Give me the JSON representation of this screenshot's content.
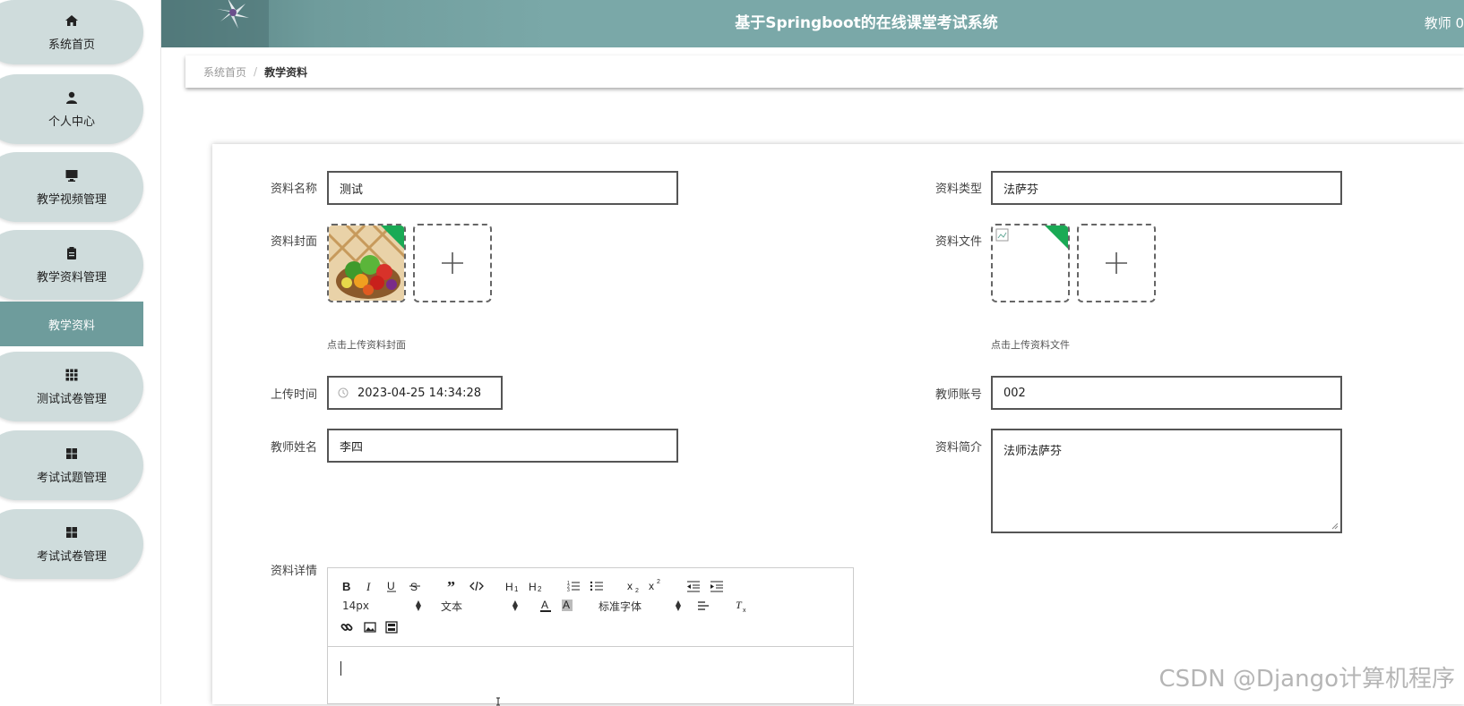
{
  "app": {
    "title": "基于Springboot的在线课堂考试系统",
    "user_label": "教师 0"
  },
  "sidebar": {
    "items": [
      {
        "label": "系统首页",
        "icon": "home-icon"
      },
      {
        "label": "个人中心",
        "icon": "user-icon"
      },
      {
        "label": "教学视频管理",
        "icon": "monitor-icon"
      },
      {
        "label": "教学资料管理",
        "icon": "clipboard-icon"
      },
      {
        "label": "测试试卷管理",
        "icon": "grid-icon"
      },
      {
        "label": "考试试题管理",
        "icon": "grid-icon"
      },
      {
        "label": "考试试卷管理",
        "icon": "grid-icon"
      }
    ],
    "active_sub_label": "教学资料"
  },
  "breadcrumb": {
    "home": "系统首页",
    "separator": "/",
    "current": "教学资料"
  },
  "form": {
    "name": {
      "label": "资料名称",
      "value": "测试"
    },
    "type": {
      "label": "资料类型",
      "value": "法萨芬"
    },
    "cover": {
      "label": "资料封面",
      "hint": "点击上传资料封面"
    },
    "file": {
      "label": "资料文件",
      "hint": "点击上传资料文件"
    },
    "upload_time": {
      "label": "上传时间",
      "value": "2023-04-25 14:34:28"
    },
    "teacher_account": {
      "label": "教师账号",
      "value": "002"
    },
    "teacher_name": {
      "label": "教师姓名",
      "value": "李四"
    },
    "summary": {
      "label": "资料简介",
      "value": "法师法萨芬"
    },
    "details": {
      "label": "资料详情"
    }
  },
  "editor": {
    "font_size": "14px",
    "paragraph": "文本",
    "font_family": "标准字体"
  },
  "watermark": "CSDN @Django计算机程序",
  "colors": {
    "header": "#7aa8a8",
    "sidebar_pill": "#cfdcdc",
    "sidebar_active": "#6e9c9c",
    "badge_green": "#1aaa55"
  }
}
